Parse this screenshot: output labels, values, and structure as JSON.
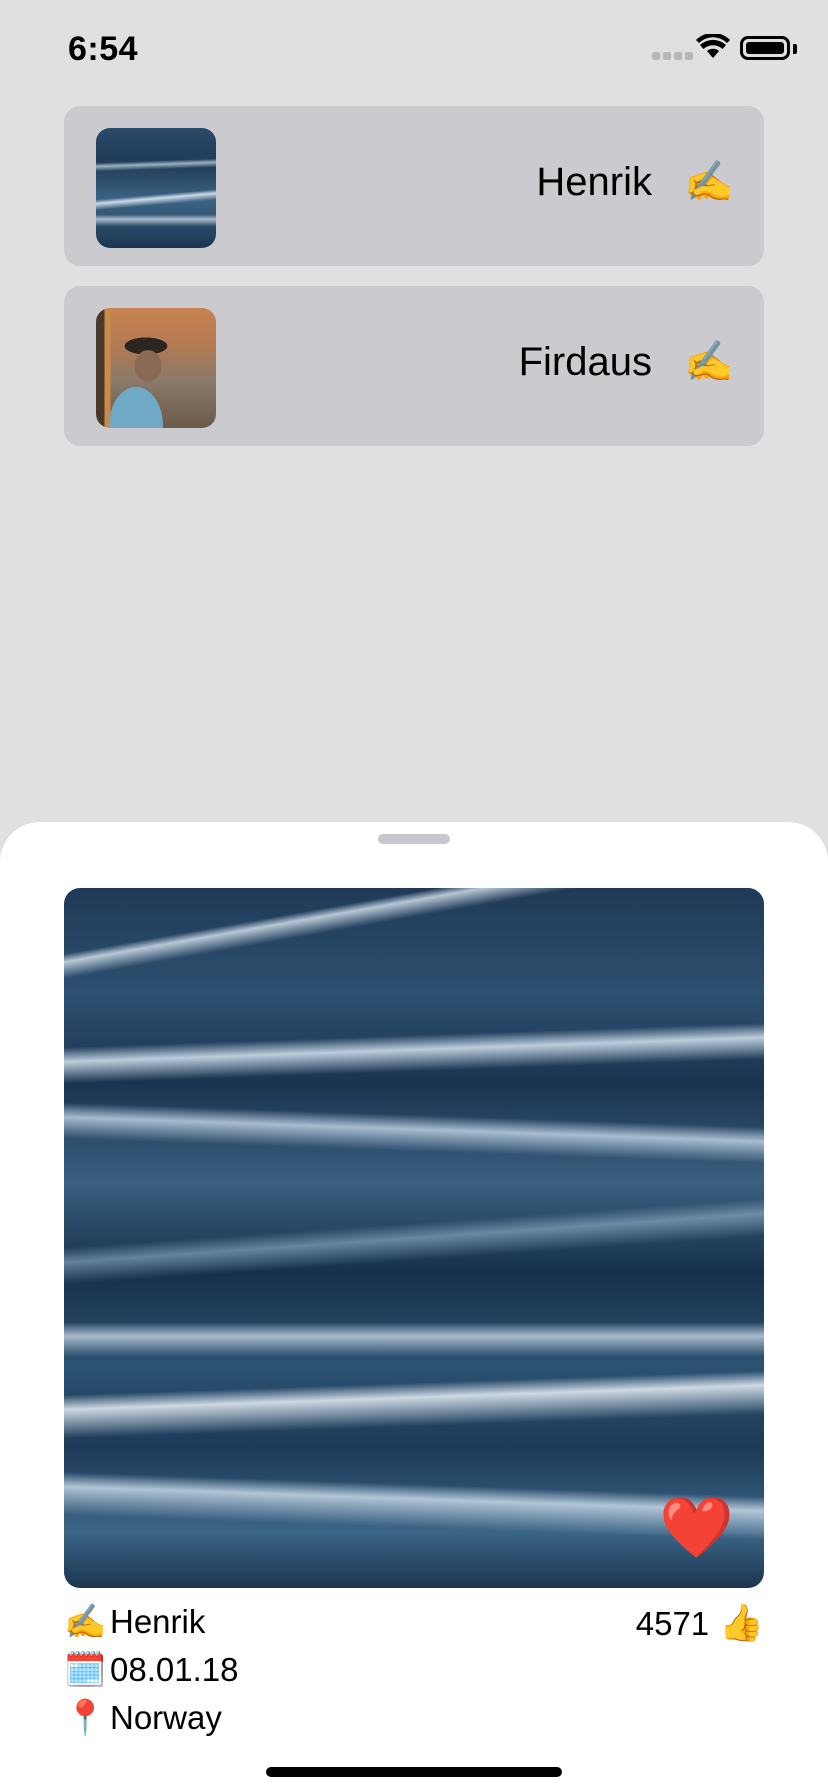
{
  "status_bar": {
    "time": "6:54"
  },
  "list": {
    "rows": [
      {
        "name": "Henrik",
        "icon": "✍️",
        "thumbnail": "ocean-painting"
      },
      {
        "name": "Firdaus",
        "icon": "✍️",
        "thumbnail": "man-with-cap"
      }
    ]
  },
  "detail": {
    "image": "ocean-painting",
    "favorite_icon": "❤️",
    "author_icon": "✍️",
    "author": "Henrik",
    "date_icon": "🗓️",
    "date": "08.01.18",
    "location_icon": "📍",
    "location": "Norway",
    "likes": "4571",
    "likes_icon": "👍"
  }
}
